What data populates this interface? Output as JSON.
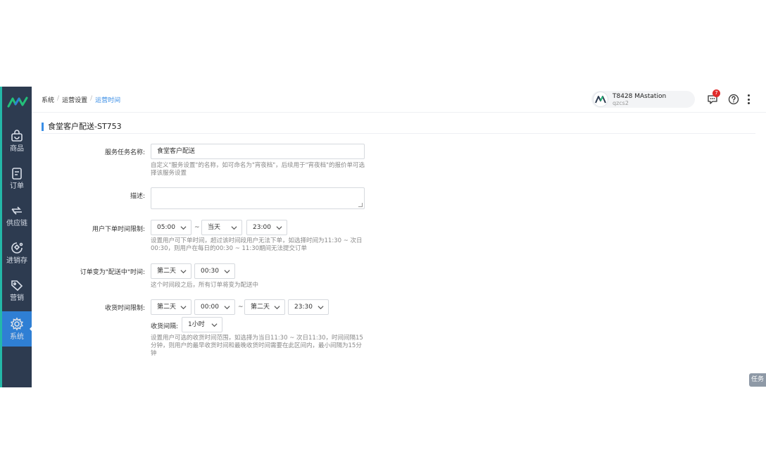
{
  "sidebar": {
    "items": [
      {
        "label": "商品",
        "icon": "shopping-bag-icon"
      },
      {
        "label": "订单",
        "icon": "order-list-icon"
      },
      {
        "label": "供应链",
        "icon": "exchange-arrows-icon"
      },
      {
        "label": "进销存",
        "icon": "inventory-icon"
      },
      {
        "label": "营销",
        "icon": "price-tag-icon"
      },
      {
        "label": "系统",
        "icon": "gear-icon"
      }
    ],
    "active": "系统"
  },
  "breadcrumb": [
    "系统",
    "运营设置",
    "运营时间"
  ],
  "breadcrumb_sep": "/",
  "user": {
    "name": "T8428 MAstation",
    "account": "qzcs2"
  },
  "notifications": {
    "count": "7"
  },
  "form": {
    "title": "食堂客户配送-ST753",
    "service_name": {
      "label": "服务任务名称:",
      "value": "食堂客户配送",
      "hint": "自定义\"服务设置\"的名称，如可命名为\"宵夜档\"，后续用于\"宵夜档\"的报价单可选择该服务设置"
    },
    "description": {
      "label": "描述:",
      "value": ""
    },
    "order_time": {
      "label": "用户下单时间限制:",
      "start": "05:00",
      "day": "当天",
      "end": "23:00",
      "tilde": "~",
      "hint": "设置用户可下单时间，超过该时间段用户无法下单，如选择时间为11:30 ~ 次日00:30，则用户在每日的00:30 ~ 11:30期间无法提交订单"
    },
    "dispatch_time": {
      "label": "订单变为\"配送中\"时间:",
      "day": "第二天",
      "time": "00:30",
      "hint": "这个时间段之后，所有订单将变为配送中"
    },
    "receive_time": {
      "label": "收货时间限制:",
      "start_day": "第二天",
      "start_time": "00:00",
      "tilde": "~",
      "end_day": "第二天",
      "end_time": "23:30",
      "interval_label": "收货间隔:",
      "interval": "1小时",
      "hint": "设置用户可选的收货时间范围，如选择为当日11:30 ~ 次日11:30，时间间隔15分钟，则用户的最早收货时间和最晚收货时间需要在此区间内，最小间隔为15分钟"
    }
  },
  "task_tab": "任务",
  "colors": {
    "sidebar_bg": "#2d3b50",
    "active_blue": "#2f7fd4",
    "link_blue": "#3a8ee6",
    "badge_red": "#e02b2b"
  }
}
